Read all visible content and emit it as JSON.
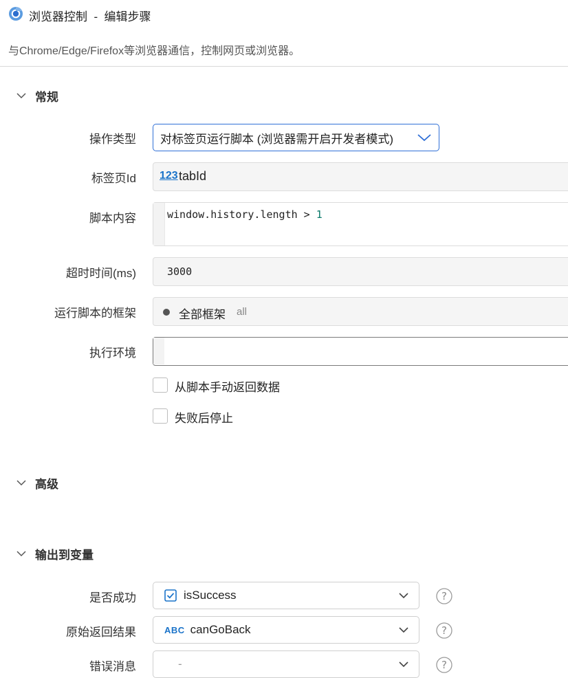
{
  "window": {
    "title": "浏览器控制  -  编辑步骤",
    "description": "与Chrome/Edge/Firefox等浏览器通信，控制网页或浏览器。"
  },
  "sections": {
    "general": "常规",
    "advanced": "高级",
    "output": "输出到变量"
  },
  "form": {
    "operation_type": {
      "label": "操作类型",
      "value": "对标签页运行脚本 (浏览器需开启开发者模式)"
    },
    "tab_id": {
      "label": "标签页Id",
      "icon_text": "123",
      "value": "tabId"
    },
    "script_content": {
      "label": "脚本内容",
      "code_text": "window.history.length > ",
      "code_number": "1"
    },
    "timeout": {
      "label": "超时时间(ms)",
      "value": "3000"
    },
    "frame": {
      "label": "运行脚本的框架",
      "value": "全部框架",
      "hint": "all"
    },
    "environment": {
      "label": "执行环境",
      "value": ""
    },
    "manual_return": {
      "label": "从脚本手动返回数据",
      "checked": false
    },
    "stop_on_fail": {
      "label": "失败后停止",
      "checked": false
    }
  },
  "outputs": {
    "is_success": {
      "label": "是否成功",
      "value": "isSuccess"
    },
    "raw_result": {
      "label": "原始返回结果",
      "icon_text": "ABC",
      "value": "canGoBack"
    },
    "error_message": {
      "label": "错误消息",
      "value": "-"
    }
  },
  "colors": {
    "accent": "#2f6fd6",
    "icon_blue": "#1a73c9",
    "field_bg": "#f5f5f5"
  }
}
